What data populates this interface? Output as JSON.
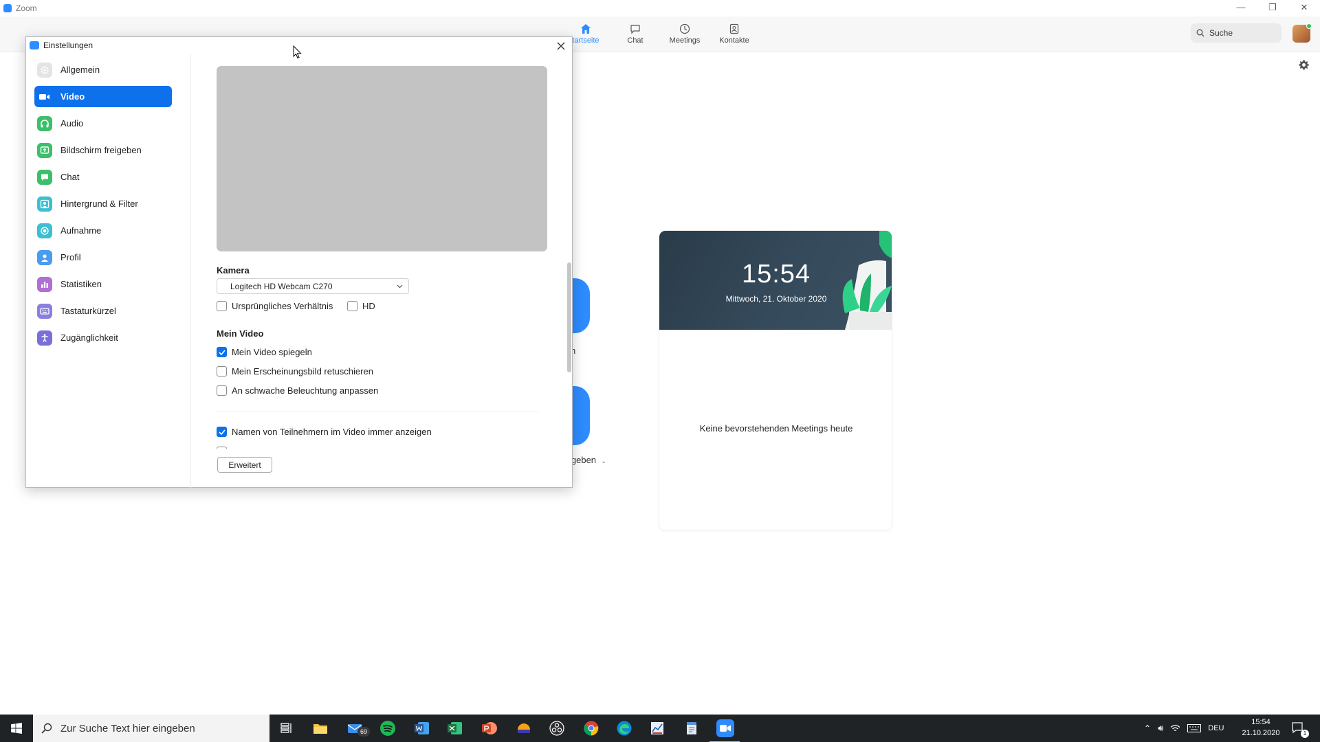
{
  "app": {
    "title": "Zoom",
    "win_controls": [
      "—",
      "❐",
      "✕"
    ]
  },
  "topnav": {
    "tabs": [
      {
        "label": "tartseite",
        "icon": "home-icon",
        "active": true
      },
      {
        "label": "Chat",
        "icon": "chat-icon",
        "active": false
      },
      {
        "label": "Meetings",
        "icon": "clock-icon",
        "active": false
      },
      {
        "label": "Kontakte",
        "icon": "contacts-icon",
        "active": false
      }
    ],
    "search_label": "Suche"
  },
  "home": {
    "fragment_1": "n",
    "fragment_2": "igeben",
    "clock": "15:54",
    "date": "Mittwoch, 21. Oktober 2020",
    "no_meetings": "Keine bevorstehenden Meetings heute"
  },
  "dialog": {
    "title": "Einstellungen",
    "sidebar": [
      {
        "label": "Allgemein",
        "icon": "gear-icon",
        "color": "#b8b8b8"
      },
      {
        "label": "Video",
        "icon": "video-camera-icon",
        "color": "#ffffff",
        "active": true
      },
      {
        "label": "Audio",
        "icon": "headphones-icon",
        "color": "#3dbf6a"
      },
      {
        "label": "Bildschirm freigeben",
        "icon": "share-screen-icon",
        "color": "#3dbf6a"
      },
      {
        "label": "Chat",
        "icon": "chat-bubble-icon",
        "color": "#3dbf6a"
      },
      {
        "label": "Hintergrund & Filter",
        "icon": "background-person-icon",
        "color": "#3cbfd2"
      },
      {
        "label": "Aufnahme",
        "icon": "record-icon",
        "color": "#3cbfd2"
      },
      {
        "label": "Profil",
        "icon": "profile-icon",
        "color": "#4a9cf0"
      },
      {
        "label": "Statistiken",
        "icon": "statistics-icon",
        "color": "#b06fd4"
      },
      {
        "label": "Tastaturkürzel",
        "icon": "keyboard-icon",
        "color": "#8a7fe0"
      },
      {
        "label": "Zugänglichkeit",
        "icon": "accessibility-icon",
        "color": "#7a6fd8"
      }
    ],
    "video": {
      "camera_label": "Kamera",
      "camera_value": "Logitech HD Webcam C270",
      "original_ratio": "Ursprüngliches Verhältnis",
      "hd": "HD",
      "my_video_label": "Mein Video",
      "mirror": "Mein Video spiegeln",
      "touch_up": "Mein Erscheinungsbild retuschieren",
      "low_light": "An schwache Beleuchtung anpassen",
      "show_names": "Namen von Teilnehmern im Video immer anzeigen",
      "advanced_button": "Erweitert"
    }
  },
  "taskbar": {
    "search_placeholder": "Zur Suche Text hier eingeben",
    "mail_badge": "69",
    "language": "DEU",
    "time": "15:54",
    "date": "21.10.2020",
    "notification_count": "1",
    "colors": {
      "word": "#2b579a",
      "excel": "#217346",
      "powerpoint": "#d24726",
      "spotify": "#1db954",
      "zoom": "#2d8cff"
    }
  }
}
